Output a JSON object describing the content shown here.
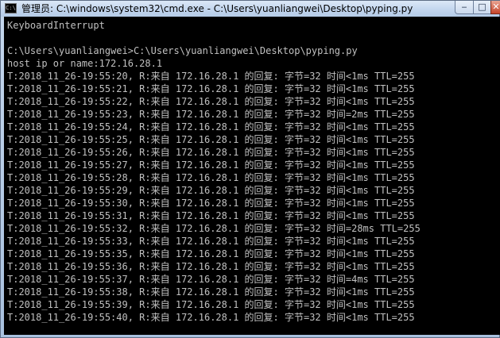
{
  "window": {
    "icon_text": "C:\\",
    "title": "管理员: C:\\windows\\system32\\cmd.exe - C:\\Users\\yuanliangwei\\Desktop\\pyping.py",
    "controls": {
      "minimize": "‒",
      "maximize": "□",
      "close": "✕"
    }
  },
  "console": {
    "lines": [
      "KeyboardInterrupt",
      "",
      "C:\\Users\\yuanliangwei>C:\\Users\\yuanliangwei\\Desktop\\pyping.py",
      "host ip or name:172.16.28.1",
      "T:2018_11_26-19:55:20, R:来自 172.16.28.1 的回复: 字节=32 时间<1ms TTL=255",
      "T:2018_11_26-19:55:21, R:来自 172.16.28.1 的回复: 字节=32 时间<1ms TTL=255",
      "T:2018_11_26-19:55:22, R:来自 172.16.28.1 的回复: 字节=32 时间<1ms TTL=255",
      "T:2018_11_26-19:55:23, R:来自 172.16.28.1 的回复: 字节=32 时间=2ms TTL=255",
      "T:2018_11_26-19:55:24, R:来自 172.16.28.1 的回复: 字节=32 时间<1ms TTL=255",
      "T:2018_11_26-19:55:25, R:来自 172.16.28.1 的回复: 字节=32 时间<1ms TTL=255",
      "T:2018_11_26-19:55:26, R:来自 172.16.28.1 的回复: 字节=32 时间<1ms TTL=255",
      "T:2018_11_26-19:55:27, R:来自 172.16.28.1 的回复: 字节=32 时间<1ms TTL=255",
      "T:2018_11_26-19:55:28, R:来自 172.16.28.1 的回复: 字节=32 时间<1ms TTL=255",
      "T:2018_11_26-19:55:29, R:来自 172.16.28.1 的回复: 字节=32 时间<1ms TTL=255",
      "T:2018_11_26-19:55:30, R:来自 172.16.28.1 的回复: 字节=32 时间<1ms TTL=255",
      "T:2018_11_26-19:55:31, R:来自 172.16.28.1 的回复: 字节=32 时间<1ms TTL=255",
      "T:2018_11_26-19:55:32, R:来自 172.16.28.1 的回复: 字节=32 时间=28ms TTL=255",
      "T:2018_11_26-19:55:33, R:来自 172.16.28.1 的回复: 字节=32 时间<1ms TTL=255",
      "T:2018_11_26-19:55:35, R:来自 172.16.28.1 的回复: 字节=32 时间<1ms TTL=255",
      "T:2018_11_26-19:55:36, R:来自 172.16.28.1 的回复: 字节=32 时间<1ms TTL=255",
      "T:2018_11_26-19:55:37, R:来自 172.16.28.1 的回复: 字节=32 时间=4ms TTL=255",
      "T:2018_11_26-19:55:38, R:来自 172.16.28.1 的回复: 字节=32 时间<1ms TTL=255",
      "T:2018_11_26-19:55:39, R:来自 172.16.28.1 的回复: 字节=32 时间<1ms TTL=255",
      "T:2018_11_26-19:55:40, R:来自 172.16.28.1 的回复: 字节=32 时间<1ms TTL=255"
    ]
  },
  "colors": {
    "console_background": "#000000",
    "console_text": "#c0c0c0",
    "title_text": "#000000"
  }
}
